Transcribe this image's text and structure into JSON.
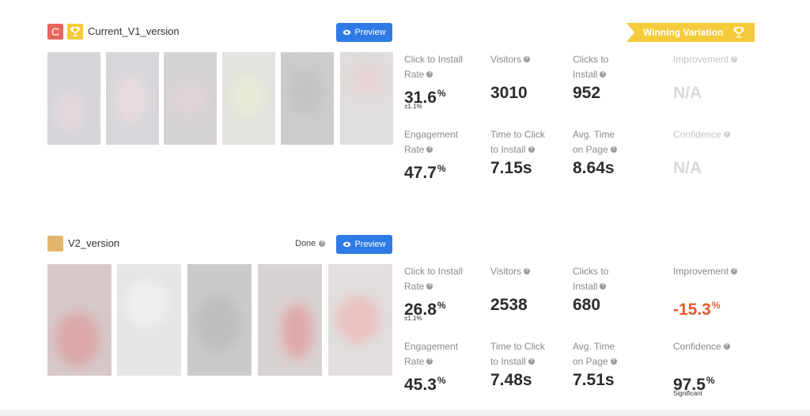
{
  "variations": [
    {
      "name": "Current_V1_version",
      "badge_letter": "C",
      "preview_label": "Preview",
      "winning_banner": "Winning Variation",
      "metrics": {
        "click_to_install_rate": {
          "label_line1": "Click to Install",
          "label_line2": "Rate",
          "value": "31.6",
          "unit": "%",
          "sub": "±1.1%"
        },
        "visitors": {
          "label": "Visitors",
          "value": "3010"
        },
        "clicks_to_install": {
          "label_line1": "Clicks to",
          "label_line2": "Install",
          "value": "952"
        },
        "improvement": {
          "label": "Improvement",
          "value": "N/A"
        },
        "engagement_rate": {
          "label_line1": "Engagement",
          "label_line2": "Rate",
          "value": "47.7",
          "unit": "%"
        },
        "time_to_click": {
          "label_line1": "Time to Click",
          "label_line2": "to Install",
          "value": "7.15s"
        },
        "avg_time": {
          "label_line1": "Avg. Time",
          "label_line2": "on Page",
          "value": "8.64s"
        },
        "confidence": {
          "label": "Confidence",
          "value": "N/A"
        }
      }
    },
    {
      "name": "V2_version",
      "status": "Done",
      "preview_label": "Preview",
      "metrics": {
        "click_to_install_rate": {
          "label_line1": "Click to Install",
          "label_line2": "Rate",
          "value": "26.8",
          "unit": "%",
          "sub": "±1.1%"
        },
        "visitors": {
          "label": "Visitors",
          "value": "2538"
        },
        "clicks_to_install": {
          "label_line1": "Clicks to",
          "label_line2": "Install",
          "value": "680"
        },
        "improvement": {
          "label": "Improvement",
          "value": "-15.3",
          "unit": "%"
        },
        "engagement_rate": {
          "label_line1": "Engagement",
          "label_line2": "Rate",
          "value": "45.3",
          "unit": "%"
        },
        "time_to_click": {
          "label_line1": "Time to Click",
          "label_line2": "to Install",
          "value": "7.48s"
        },
        "avg_time": {
          "label_line1": "Avg. Time",
          "label_line2": "on Page",
          "value": "7.51s"
        },
        "confidence": {
          "label": "Confidence",
          "value": "97.5",
          "unit": "%",
          "sub": "Significant"
        }
      }
    }
  ],
  "colors": {
    "preview_button": "#2e7be6",
    "winning_banner": "#f5cb3b",
    "badge_current": "#e8675d",
    "badge_v2": "#e2b66a",
    "negative_improvement": "#e85a2c",
    "disabled_value": "#d9d9d9"
  },
  "icons": {
    "preview": "eye-icon",
    "winner": "trophy-icon",
    "help": "question-circle-icon"
  }
}
